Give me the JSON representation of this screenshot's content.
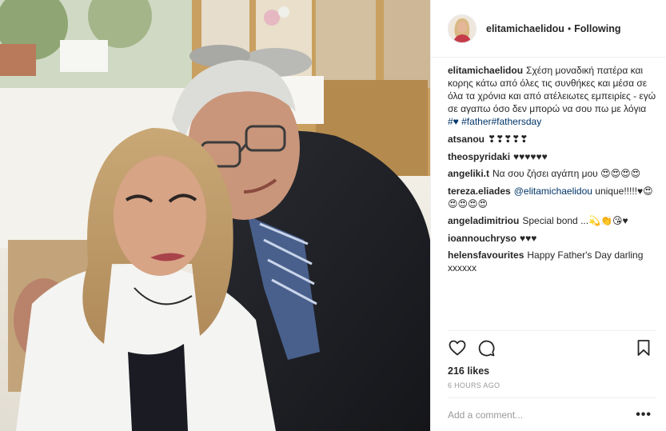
{
  "header": {
    "username": "elitamichaelidou",
    "separator": "•",
    "follow_status": "Following",
    "avatar_icon": "user-avatar"
  },
  "caption": {
    "username": "elitamichaelidou",
    "text": "Σχέση μοναδική πατέρα και κορης κάτω από όλες τις συνθήκες και μέσα σε όλα τα χρόνια και από ατέλειωτες εμπειρίες - εγώ σε αγαπω όσο δεν μπορώ να σου πω με λόγια ",
    "hashtags": "#♥ #father#fathersday"
  },
  "comments": [
    {
      "username": "atsanou",
      "text": "❣❣❣❣❣"
    },
    {
      "username": "theospyridaki",
      "text": "♥♥♥♥♥♥"
    },
    {
      "username": "angeliki.t",
      "text": "Να σου ζήσει αγάπη μου 😍😍😍😍"
    },
    {
      "username": "tereza.eliades",
      "mention": "@elitamichaelidou",
      "text": " unique!!!!!♥😍😍😍😍😍"
    },
    {
      "username": "angeladimitriou",
      "text": "Special bond ...💫👏😘♥"
    },
    {
      "username": "ioannouchryso",
      "text": "♥♥♥"
    },
    {
      "username": "helensfavourites",
      "text": "Happy Father's Day darling xxxxxx"
    }
  ],
  "actions": {
    "like_icon": "heart-icon",
    "comment_icon": "comment-icon",
    "save_icon": "bookmark-icon"
  },
  "likes": "216 likes",
  "timestamp": "6 HOURS AGO",
  "add_comment": {
    "placeholder": "Add a comment...",
    "more_label": "•••"
  }
}
